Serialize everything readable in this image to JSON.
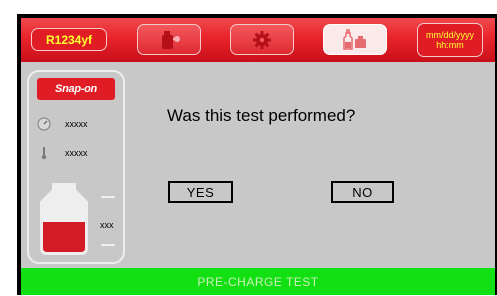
{
  "header": {
    "refrigerant_label": "R1234yf",
    "tabs": [
      {
        "icon": "vacuum-pump-icon",
        "active": false
      },
      {
        "icon": "gear-icon",
        "active": false
      },
      {
        "icon": "oil-bottles-icon",
        "active": true
      }
    ],
    "date_label": "mm/dd/yyyy",
    "time_label": "hh:mm"
  },
  "side_panel": {
    "logo_text": "Snap-on",
    "pressure_icon": "gauge-icon",
    "pressure_value": "xxxxx",
    "temperature_icon": "thermometer-icon",
    "temperature_value": "xxxxx",
    "tank_icon": "refrigerant-tank-icon",
    "tank_value": "xxx",
    "tank_fill_fraction": 0.6
  },
  "dialog": {
    "question": "Was this test performed?",
    "yes_label": "YES",
    "no_label": "NO"
  },
  "status_bar": {
    "text": "PRE-CHARGE TEST"
  },
  "colors": {
    "header_red": "#e8242b",
    "label_yellow": "#ffff30",
    "body_gray": "#c8c8c8",
    "status_green": "#12e012",
    "tank_red": "#d41c26"
  }
}
